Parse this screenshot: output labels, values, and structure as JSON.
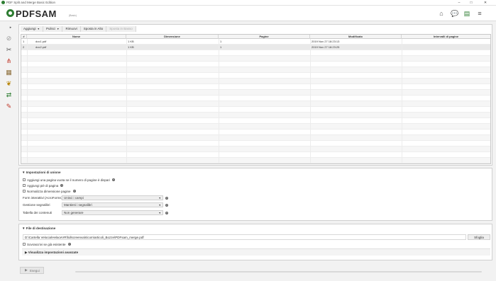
{
  "window": {
    "title": "PDF Split and Merge Basic Edition",
    "controls": [
      "–",
      "□",
      "✕"
    ]
  },
  "header": {
    "logo_text": "PDFSAM",
    "logo_sub": "(Basic)",
    "icons": [
      "home-icon",
      "news-icon",
      "module-icon",
      "menu-icon"
    ]
  },
  "sidebar": {
    "items": [
      "merge-icon",
      "split-icon",
      "split-bookmarks-icon",
      "split-size-icon",
      "extract-icon",
      "alternate-mix-icon",
      "rotate-icon"
    ]
  },
  "toolbar": {
    "add_label": "Aggiungi",
    "clear_label": "Pulisci",
    "remove_label": "Rimuovi",
    "move_up_label": "Sposta in Alto",
    "move_down_label": "Sposta in Basso"
  },
  "table": {
    "columns": [
      "#",
      "Nome",
      "Dimensione",
      "Pagine",
      "Modificato",
      "Intervalli di pagine"
    ],
    "rows": [
      {
        "idx": "1",
        "name": "doc1.pdf",
        "size": "1 KB",
        "pages": "1",
        "modified": "2019 Nov 27 18:23:13",
        "ranges": ""
      },
      {
        "idx": "2",
        "name": "doc2.pdf",
        "size": "1 KB",
        "pages": "1",
        "modified": "2019 Nov 27 18:23:25",
        "ranges": ""
      }
    ]
  },
  "merge_settings": {
    "title": "Impostazioni di unione",
    "blank_page_label": "Aggiungi una pagina vuota se il numero di pagine è dispari",
    "footer_label": "Aggiungi piè di pagina",
    "normalize_label": "Normalizza dimensione pagine",
    "acroforms_label": "Form interattivi (AcroForms)",
    "acroforms_value": "Unisci i campi",
    "bookmarks_label": "Gestione segnalibri",
    "bookmarks_value": "Mantieni i segnalibri",
    "toc_label": "Tabella dei contenuti",
    "toc_value": "Non generare"
  },
  "destination": {
    "title": "File di destinazione",
    "path": "D:\\Cartella Velocia\\HelaceVR\\fullscreenvals\\com\\articoli_Bozze\\PDFsam_merge.pdf",
    "browse_label": "Sfoglia",
    "overwrite_label": "Sovrascrivi se già esistente",
    "advanced_label": "Visualizza impostazioni avanzate"
  },
  "footer": {
    "run_label": "Esegui",
    "progress": 0.0
  },
  "colors": {
    "accent": "#2e7d32"
  }
}
